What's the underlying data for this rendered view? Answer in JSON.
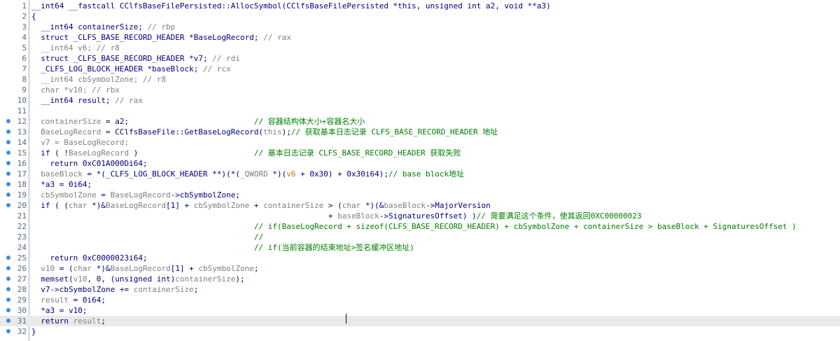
{
  "editor": {
    "lines": [
      {
        "num": "1",
        "bp": false,
        "text": "__int64 __fastcall CClfsBaseFilePersisted::AllocSymbol(CClfsBaseFilePersisted *this, unsigned int a2, void **a3)",
        "segs": [
          {
            "t": "__int64 __fastcall CClfsBaseFilePersisted::AllocSymbol(CClfsBaseFilePersisted *this, unsigned int a2, void **a3)",
            "c": "#000080"
          }
        ]
      },
      {
        "num": "2",
        "bp": false,
        "text": "{",
        "segs": [
          {
            "t": "{",
            "c": "#000080"
          }
        ]
      },
      {
        "num": "3",
        "bp": false,
        "text": "  __int64 containerSize; // rbp",
        "segs": [
          {
            "t": "  __int64 containerSize; ",
            "c": "#000080"
          },
          {
            "t": "// rbp",
            "c": "#808080"
          }
        ]
      },
      {
        "num": "4",
        "bp": false,
        "text": "  struct _CLFS_BASE_RECORD_HEADER *BaseLogRecord; // rax",
        "segs": [
          {
            "t": "  struct _CLFS_BASE_RECORD_HEADER *BaseLogRecord; ",
            "c": "#000080"
          },
          {
            "t": "// rax",
            "c": "#808080"
          }
        ]
      },
      {
        "num": "5",
        "bp": false,
        "text": "  __int64 v6; // r8",
        "segs": [
          {
            "t": "  __int64 v6; ",
            "c": "#808080"
          },
          {
            "t": "// r8",
            "c": "#808080"
          }
        ]
      },
      {
        "num": "6",
        "bp": false,
        "text": "  struct _CLFS_BASE_RECORD_HEADER *v7; // rdi",
        "segs": [
          {
            "t": "  struct _CLFS_BASE_RECORD_HEADER *v7; ",
            "c": "#000080"
          },
          {
            "t": "// rdi",
            "c": "#808080"
          }
        ]
      },
      {
        "num": "7",
        "bp": false,
        "text": "  _CLFS_LOG_BLOCK_HEADER *baseBlock; // rcx",
        "segs": [
          {
            "t": "  _CLFS_LOG_BLOCK_HEADER *baseBlock; ",
            "c": "#000080"
          },
          {
            "t": "// rcx",
            "c": "#808080"
          }
        ]
      },
      {
        "num": "8",
        "bp": false,
        "text": "  __int64 cbSymbolZone; // r8",
        "segs": [
          {
            "t": "  __int64 cbSymbolZone; ",
            "c": "#808080"
          },
          {
            "t": "// r8",
            "c": "#808080"
          }
        ]
      },
      {
        "num": "9",
        "bp": false,
        "text": "  char *v10; // rbx",
        "segs": [
          {
            "t": "  char *v10; ",
            "c": "#808080"
          },
          {
            "t": "// rbx",
            "c": "#808080"
          }
        ]
      },
      {
        "num": "10",
        "bp": false,
        "text": "  __int64 result; // rax",
        "segs": [
          {
            "t": "  __int64 result; ",
            "c": "#000080"
          },
          {
            "t": "// rax",
            "c": "#808080"
          }
        ]
      },
      {
        "num": "11",
        "bp": false,
        "text": "",
        "segs": []
      },
      {
        "num": "12",
        "bp": true,
        "text": "  containerSize = a2;                           // 容器结构体大小+容器名大小",
        "segs": [
          {
            "t": "  containerSize",
            "c": "#808080"
          },
          {
            "t": " = a2;                           ",
            "c": "#000080"
          },
          {
            "t": "// 容器结构体大小+容器名大小",
            "c": "#008000"
          }
        ]
      },
      {
        "num": "13",
        "bp": true,
        "text": "  BaseLogRecord = CClfsBaseFile::GetBaseLogRecord(this);// 获取基本日志记录 CLFS_BASE_RECORD_HEADER 地址",
        "segs": [
          {
            "t": "  BaseLogRecord",
            "c": "#808080"
          },
          {
            "t": " = CClfsBaseFile::GetBaseLogRecord(",
            "c": "#000080"
          },
          {
            "t": "this",
            "c": "#808080"
          },
          {
            "t": ");",
            "c": "#000080"
          },
          {
            "t": "// 获取基本日志记录 CLFS_BASE_RECORD_HEADER 地址",
            "c": "#008000"
          }
        ]
      },
      {
        "num": "14",
        "bp": true,
        "text": "  v7 = BaseLogRecord;",
        "segs": [
          {
            "t": "  v7 = BaseLogRecord;",
            "c": "#808080"
          }
        ]
      },
      {
        "num": "15",
        "bp": true,
        "text": "  if ( !BaseLogRecord )                         // 基本日志记录 CLFS_BASE_RECORD_HEADER 获取失败",
        "segs": [
          {
            "t": "  if ( !",
            "c": "#000080"
          },
          {
            "t": "BaseLogRecord",
            "c": "#808080"
          },
          {
            "t": " )                         ",
            "c": "#000080"
          },
          {
            "t": "// 基本日志记录 CLFS_BASE_RECORD_HEADER 获取失败",
            "c": "#008000"
          }
        ]
      },
      {
        "num": "16",
        "bp": true,
        "text": "    return 0xC01A000Di64;",
        "segs": [
          {
            "t": "    return 0xC01A000Di64;",
            "c": "#000080"
          }
        ]
      },
      {
        "num": "17",
        "bp": true,
        "text": "  baseBlock = *(_CLFS_LOG_BLOCK_HEADER **)(*(_QWORD *)(v6 + 0x30) + 0x30i64);// base block地址",
        "segs": [
          {
            "t": "  baseBlock",
            "c": "#808080"
          },
          {
            "t": " = *(_CLFS_LOG_BLOCK_HEADER **)(*(",
            "c": "#000080"
          },
          {
            "t": "_QWORD",
            "c": "#808080"
          },
          {
            "t": " *)(",
            "c": "#000080"
          },
          {
            "t": "v6",
            "c": "#c0761a"
          },
          {
            "t": " + 0x30) + 0x30i64);",
            "c": "#000080"
          },
          {
            "t": "// base block地址",
            "c": "#008000"
          }
        ]
      },
      {
        "num": "18",
        "bp": true,
        "text": "  *a3 = 0i64;",
        "segs": [
          {
            "t": "  *a3 = 0i64;",
            "c": "#000080"
          }
        ]
      },
      {
        "num": "19",
        "bp": true,
        "text": "  cbSymbolZone = BaseLogRecord->cbSymbolZone;",
        "segs": [
          {
            "t": "  cbSymbolZone",
            "c": "#808080"
          },
          {
            "t": " = ",
            "c": "#000080"
          },
          {
            "t": "BaseLogRecord",
            "c": "#808080"
          },
          {
            "t": "->cbSymbolZone;",
            "c": "#000080"
          }
        ]
      },
      {
        "num": "20",
        "bp": true,
        "text": "  if ( (char *)&BaseLogRecord[1] + cbSymbolZone + containerSize > (char *)(&baseBlock->MajorVersion",
        "segs": [
          {
            "t": "  if ( (",
            "c": "#000080"
          },
          {
            "t": "char",
            "c": "#808080"
          },
          {
            "t": " *)&",
            "c": "#000080"
          },
          {
            "t": "BaseLogRecord",
            "c": "#808080"
          },
          {
            "t": "[1] + ",
            "c": "#000080"
          },
          {
            "t": "cbSymbolZone",
            "c": "#808080"
          },
          {
            "t": " + ",
            "c": "#000080"
          },
          {
            "t": "containerSize",
            "c": "#808080"
          },
          {
            "t": " > (",
            "c": "#000080"
          },
          {
            "t": "char",
            "c": "#808080"
          },
          {
            "t": " *)(&",
            "c": "#000080"
          },
          {
            "t": "baseBlock",
            "c": "#808080"
          },
          {
            "t": "->MajorVersion",
            "c": "#000080"
          }
        ]
      },
      {
        "num": "21",
        "bp": false,
        "text": "                                                                + baseBlock->SignaturesOffset) )// 需要满足这个条件，使其返回0XC00000023",
        "segs": [
          {
            "t": "                                                                + ",
            "c": "#000080"
          },
          {
            "t": "baseBlock",
            "c": "#808080"
          },
          {
            "t": "->SignaturesOffset) )",
            "c": "#000080"
          },
          {
            "t": "// 需要满足这个条件，使其返回0XC00000023",
            "c": "#008000"
          }
        ]
      },
      {
        "num": "22",
        "bp": false,
        "text": "                                                // if(BaseLogRecord + sizeof(CLFS_BASE_RECORD_HEADER) + cbSymbolZone + containerSize > baseBlock + SignaturesOffset )",
        "segs": [
          {
            "t": "                                                ",
            "c": "#000080"
          },
          {
            "t": "// if(BaseLogRecord + sizeof(CLFS_BASE_RECORD_HEADER) + cbSymbolZone + containerSize > baseBlock + SignaturesOffset )",
            "c": "#008000"
          }
        ]
      },
      {
        "num": "23",
        "bp": false,
        "text": "                                                //",
        "segs": [
          {
            "t": "                                                ",
            "c": "#000080"
          },
          {
            "t": "//",
            "c": "#008000"
          }
        ]
      },
      {
        "num": "24",
        "bp": false,
        "text": "                                                // if(当前容器的结束地址>签名缓冲区地址)",
        "segs": [
          {
            "t": "                                                ",
            "c": "#000080"
          },
          {
            "t": "// if(当前容器的结束地址>签名缓冲区地址)",
            "c": "#008000"
          }
        ]
      },
      {
        "num": "25",
        "bp": true,
        "text": "    return 0xC0000023i64;",
        "segs": [
          {
            "t": "    return 0xC0000023i64;",
            "c": "#000080"
          }
        ]
      },
      {
        "num": "26",
        "bp": true,
        "text": "  v10 = (char *)&BaseLogRecord[1] + cbSymbolZone;",
        "segs": [
          {
            "t": "  v10",
            "c": "#808080"
          },
          {
            "t": " = (",
            "c": "#000080"
          },
          {
            "t": "char",
            "c": "#808080"
          },
          {
            "t": " *)&",
            "c": "#000080"
          },
          {
            "t": "BaseLogRecord",
            "c": "#808080"
          },
          {
            "t": "[1] + ",
            "c": "#000080"
          },
          {
            "t": "cbSymbolZone",
            "c": "#808080"
          },
          {
            "t": ";",
            "c": "#000080"
          }
        ]
      },
      {
        "num": "27",
        "bp": true,
        "text": "  memset(v10, 0, (unsigned int)containerSize);",
        "segs": [
          {
            "t": "  memset(",
            "c": "#000080"
          },
          {
            "t": "v10",
            "c": "#808080"
          },
          {
            "t": ", 0, (unsigned int)",
            "c": "#000080"
          },
          {
            "t": "containerSize",
            "c": "#808080"
          },
          {
            "t": ");",
            "c": "#000080"
          }
        ]
      },
      {
        "num": "28",
        "bp": true,
        "text": "  v7->cbSymbolZone += containerSize;",
        "segs": [
          {
            "t": "  v7->cbSymbolZone += ",
            "c": "#000080"
          },
          {
            "t": "containerSize",
            "c": "#808080"
          },
          {
            "t": ";",
            "c": "#000080"
          }
        ]
      },
      {
        "num": "29",
        "bp": true,
        "text": "  result = 0i64;",
        "segs": [
          {
            "t": "  result",
            "c": "#808080"
          },
          {
            "t": " = 0i64;",
            "c": "#000080"
          }
        ]
      },
      {
        "num": "30",
        "bp": true,
        "text": "  *a3 = v10;",
        "segs": [
          {
            "t": "  *a3 = v10;",
            "c": "#000080"
          }
        ]
      },
      {
        "num": "31",
        "bp": true,
        "text": "  return result;",
        "segs": [
          {
            "t": "  return ",
            "c": "#000080"
          },
          {
            "t": "result",
            "c": "#808080"
          },
          {
            "t": ";",
            "c": "#000080"
          }
        ]
      },
      {
        "num": "32",
        "bp": true,
        "text": "}",
        "segs": [
          {
            "t": "}",
            "c": "#000080"
          }
        ]
      }
    ],
    "current_line": 31,
    "colors": {
      "keyword": "#000080",
      "variable": "#808080",
      "comment": "#008000",
      "highlight": "#c0761a",
      "breakpoint": "#3b8ee0",
      "current_line_bg": "#e9e9e9"
    }
  }
}
